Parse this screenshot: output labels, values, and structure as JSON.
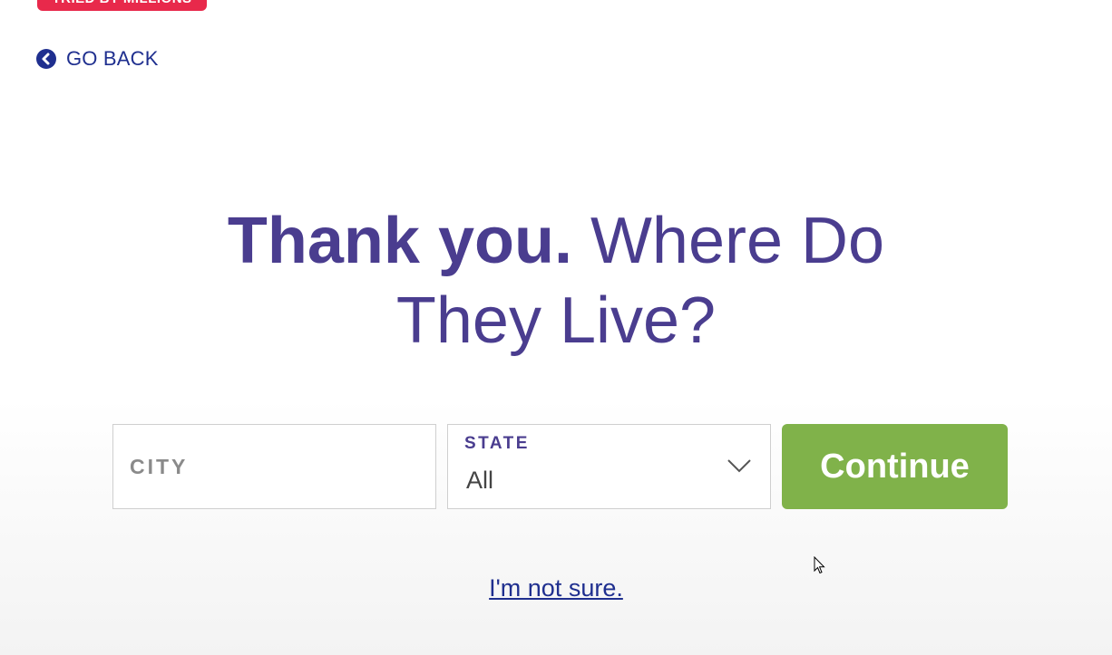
{
  "badge": {
    "text": "TRIED BY MILLIONS"
  },
  "nav": {
    "go_back_label": "GO BACK",
    "icon": "chevron-left-circle-icon"
  },
  "headline": {
    "bold_part": "Thank you.",
    "light_part_1": " Where Do",
    "light_part_2": "They Live?"
  },
  "form": {
    "city_placeholder": "CITY",
    "city_value": "",
    "state_label": "STATE",
    "state_value": "All",
    "continue_label": "Continue"
  },
  "links": {
    "not_sure": "I'm not sure."
  },
  "colors": {
    "brand_purple": "#4a3d8f",
    "nav_blue": "#1f2f8f",
    "button_green": "#80b24a",
    "badge_red": "#e8294b"
  }
}
